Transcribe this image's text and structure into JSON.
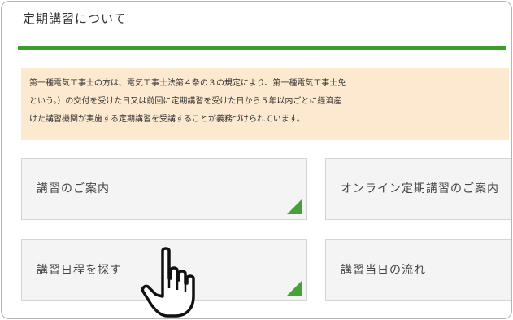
{
  "section": {
    "title": "定期講習について"
  },
  "notice": {
    "lines": [
      "第一種電気工事士の方は、電気工事士法第４条の３の規定により、第一種電気工事士免",
      "という。）の交付を受けた日又は前回に定期講習を受けた日から５年以内ごとに経済産",
      "けた講習機関が実施する定期講習を受講することが義務づけられています。"
    ]
  },
  "cards": [
    {
      "label": "講習のご案内"
    },
    {
      "label": "オンライン定期講習のご案内"
    },
    {
      "label": "講習日程を探す"
    },
    {
      "label": "講習当日の流れ"
    }
  ],
  "icons": {
    "cursor": "hand-pointer-icon",
    "card_corner": "green-corner-triangle-icon"
  },
  "colors": {
    "accent": "#3f9b2c",
    "notice_background": "#fde9cf",
    "card_background": "#f4f4f4"
  }
}
